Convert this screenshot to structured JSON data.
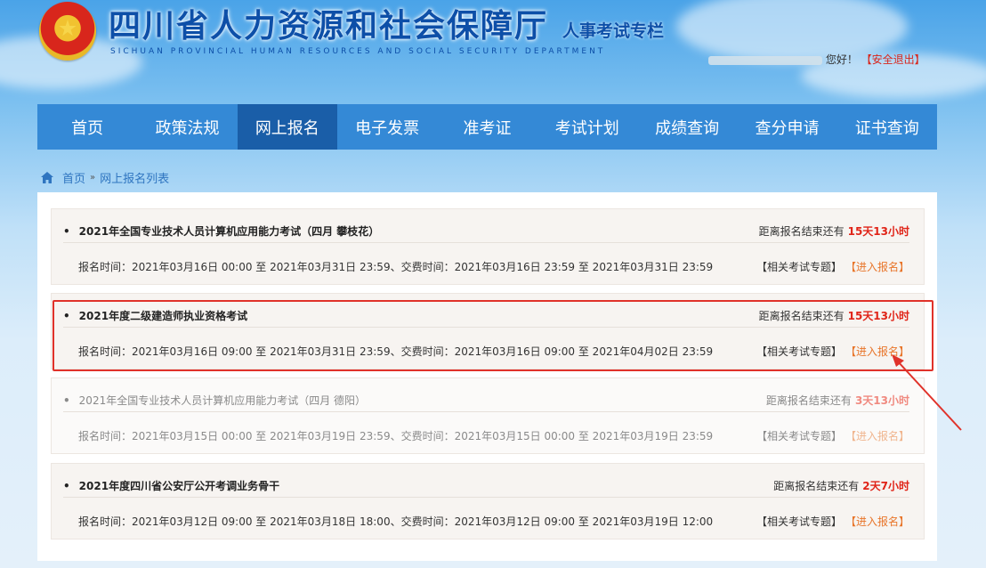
{
  "header": {
    "site_title": "四川省人力资源和社会保障厅",
    "subtitle": "人事考试专栏",
    "english_name": "SICHUAN PROVINCIAL HUMAN RESOURCES AND SOCIAL SECURITY DEPARTMENT",
    "user_suffix": "您好！",
    "logout_label": "【安全退出】"
  },
  "nav": {
    "items": [
      "首页",
      "政策法规",
      "网上报名",
      "电子发票",
      "准考证",
      "考试计划",
      "成绩查询",
      "查分申请",
      "证书查询"
    ],
    "active": "网上报名"
  },
  "breadcrumb": {
    "home": "首页",
    "separator": "»",
    "current": "网上报名列表"
  },
  "exams": [
    {
      "title": "2021年全国专业技术人员计算机应用能力考试（四月 攀枝花）",
      "countdown_label": "距离报名结束还有",
      "countdown_value": "15天13小时",
      "times": "报名时间：2021年03月16日 00:00 至 2021年03月31日 23:59、交费时间：2021年03月16日 23:59 至 2021年03月31日 23:59",
      "related_label": "【相关考试专题】",
      "enter_label": "【进入报名】"
    },
    {
      "title": "2021年度二级建造师执业资格考试",
      "countdown_label": "距离报名结束还有",
      "countdown_value": "15天13小时",
      "times": "报名时间：2021年03月16日 09:00 至 2021年03月31日 23:59、交费时间：2021年03月16日 09:00 至 2021年04月02日 23:59",
      "related_label": "【相关考试专题】",
      "enter_label": "【进入报名】"
    },
    {
      "title": "2021年全国专业技术人员计算机应用能力考试（四月 德阳）",
      "countdown_label": "距离报名结束还有",
      "countdown_value": "3天13小时",
      "times": "报名时间：2021年03月15日 00:00 至 2021年03月19日 23:59、交费时间：2021年03月15日 00:00 至 2021年03月19日 23:59",
      "related_label": "【相关考试专题】",
      "enter_label": "【进入报名】"
    },
    {
      "title": "2021年度四川省公安厅公开考调业务骨干",
      "countdown_label": "距离报名结束还有",
      "countdown_value": "2天7小时",
      "times": "报名时间：2021年03月12日 09:00 至 2021年03月18日 18:00、交费时间：2021年03月12日 09:00 至 2021年03月19日 12:00",
      "related_label": "【相关考试专题】",
      "enter_label": "【进入报名】"
    }
  ],
  "colors": {
    "nav_bg": "#3489d6",
    "nav_active": "#1a5ea8",
    "highlight": "#e0322a",
    "countdown": "#e02418",
    "enter_link": "#e8752a"
  }
}
